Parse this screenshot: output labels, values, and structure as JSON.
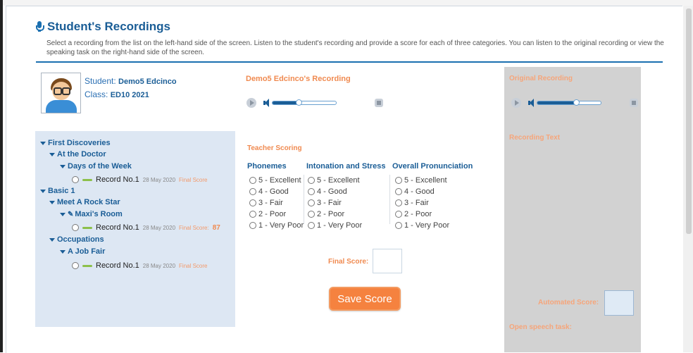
{
  "header": {
    "title": "Student's Recordings",
    "description": "Select a recording from the list on the left-hand side of the screen. Listen to the student's recording and provide a score for each of three categories. You can listen to the original recording or view the speaking task on the right-hand side of the screen."
  },
  "student": {
    "student_label": "Student:",
    "student_name": "Demo5 Edcinco",
    "class_label": "Class:",
    "class_name": "ED10 2021"
  },
  "tree": {
    "first_discoveries": "First Discoveries",
    "at_the_doctor": "At the Doctor",
    "days_of_week": "Days of the Week",
    "basic1": "Basic 1",
    "meet_rock_star": "Meet A Rock Star",
    "maxis_room": "Maxi's Room",
    "occupations": "Occupations",
    "job_fair": "A Job Fair",
    "records": [
      {
        "name": "Record No.1",
        "date": "28 May 2020",
        "final_label": "Final Score",
        "score": ""
      },
      {
        "name": "Record No.1",
        "date": "28 May 2020",
        "final_label": "Final Score:",
        "score": "87"
      },
      {
        "name": "Record No.1",
        "date": "28 May 2020",
        "final_label": "Final Score",
        "score": ""
      }
    ]
  },
  "recording": {
    "title": "Demo5 Edcinco's Recording",
    "progress_fraction": 0.4
  },
  "scoring": {
    "title": "Teacher Scoring",
    "columns": [
      "Phonemes",
      "Intonation and Stress",
      "Overall Pronunciation"
    ],
    "options": [
      "5 - Excellent",
      "4 - Good",
      "3 - Fair",
      "2 - Poor",
      "1 - Very Poor"
    ],
    "final_score_label": "Final Score:",
    "save_label": "Save Score"
  },
  "original": {
    "title": "Original Recording",
    "recording_text_label": "Recording Text",
    "automated_score_label": "Automated Score:",
    "open_speech_label": "Open speech task:",
    "progress_fraction": 0.6
  },
  "colors": {
    "accent_blue": "#1a5d96",
    "accent_orange": "#f5823f",
    "tree_bg": "#dde7f3",
    "right_panel_bg": "#d2d2d2"
  }
}
